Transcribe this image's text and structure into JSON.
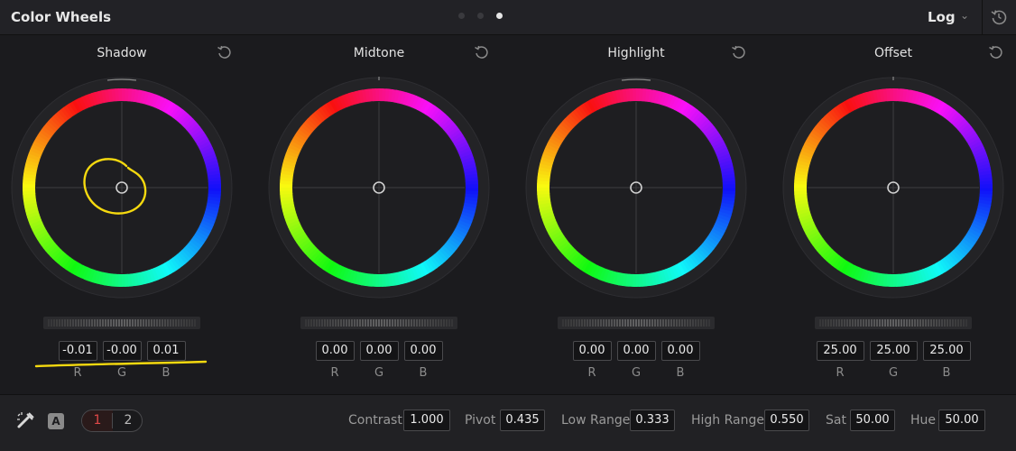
{
  "header": {
    "title": "Color Wheels",
    "mode": "Log",
    "pages": [
      false,
      false,
      true
    ]
  },
  "wheels": [
    {
      "label": "Shadow",
      "values": [
        "-0.01",
        "-0.00",
        "0.01"
      ],
      "channels": [
        "R",
        "G",
        "B"
      ]
    },
    {
      "label": "Midtone",
      "values": [
        "0.00",
        "0.00",
        "0.00"
      ],
      "channels": [
        "R",
        "G",
        "B"
      ]
    },
    {
      "label": "Highlight",
      "values": [
        "0.00",
        "0.00",
        "0.00"
      ],
      "channels": [
        "R",
        "G",
        "B"
      ]
    },
    {
      "label": "Offset",
      "values": [
        "25.00",
        "25.00",
        "25.00"
      ],
      "channels": [
        "R",
        "G",
        "B"
      ]
    }
  ],
  "footer": {
    "auto_button": "A",
    "pages": [
      "1",
      "2"
    ],
    "params": [
      {
        "label": "Contrast",
        "value": "1.000"
      },
      {
        "label": "Pivot",
        "value": "0.435"
      },
      {
        "label": "Low Range",
        "value": "0.333"
      },
      {
        "label": "High Range",
        "value": "0.550"
      },
      {
        "label": "Sat",
        "value": "50.00"
      },
      {
        "label": "Hue",
        "value": "50.00"
      }
    ]
  },
  "colors": {
    "annotation": "#f5d90f",
    "active_page": "#e04848"
  },
  "icons": {
    "reset": "reset-icon",
    "picker": "color-picker-icon",
    "chevron": "chevron-down-icon"
  }
}
